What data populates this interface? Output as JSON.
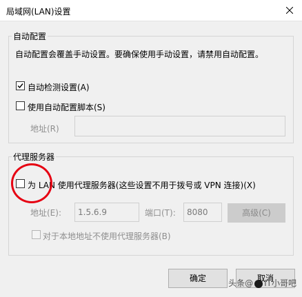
{
  "window": {
    "title": "局域网(LAN)设置",
    "close_glyph": "✕"
  },
  "auto_config": {
    "group_label": "自动配置",
    "description": "自动配置会覆盖手动设置。要确保使用手动设置，请禁用自动配置。",
    "auto_detect": {
      "label": "自动检测设置(A)",
      "checked": true
    },
    "auto_script": {
      "label": "使用自动配置脚本(S)",
      "checked": false
    },
    "address_label": "地址(R)",
    "address_value": ""
  },
  "proxy": {
    "group_label": "代理服务器",
    "use_proxy": {
      "label": "为 LAN 使用代理服务器(这些设置不用于拨号或 VPN 连接)(X)",
      "checked": false
    },
    "address_label": "地址(E):",
    "address_value": "1.5.6.9",
    "port_label": "端口(T):",
    "port_value": "8080",
    "advanced_label": "高级(C)",
    "bypass_local": {
      "label": "对于本地地址不使用代理服务器(B)",
      "checked": false
    }
  },
  "buttons": {
    "ok": "确定",
    "cancel": "取消"
  },
  "watermark": {
    "prefix": "头条",
    "at": "@",
    "name": "IT小哥吧"
  },
  "colors": {
    "annotation_circle": "#e60012"
  }
}
